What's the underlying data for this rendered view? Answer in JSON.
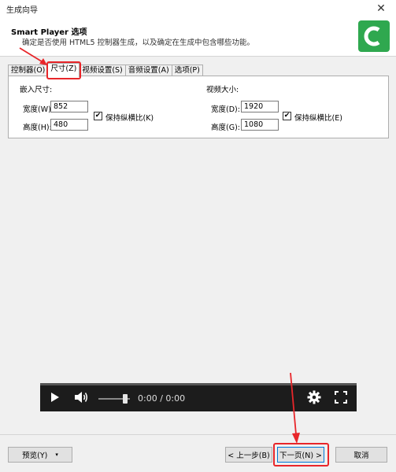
{
  "window": {
    "title": "生成向导",
    "close_glyph": "✕"
  },
  "header": {
    "title": "Smart Player 选项",
    "subtitle": "确定是否使用 HTML5 控制器生成，以及确定在生成中包含哪些功能。",
    "logo_color": "#2fa84f"
  },
  "tabs": [
    {
      "label": "控制器(O)"
    },
    {
      "label": "尺寸(Z)",
      "active": true
    },
    {
      "label": "视频设置(S)"
    },
    {
      "label": "音频设置(A)"
    },
    {
      "label": "选项(P)"
    }
  ],
  "embed": {
    "heading": "嵌入尺寸:",
    "width_label": "宽度(W):",
    "width_value": "852",
    "height_label": "高度(H):",
    "height_value": "480",
    "keep_ratio_label": "保持纵横比(K)",
    "keep_ratio_checked": true
  },
  "video": {
    "heading": "视频大小:",
    "width_label": "宽度(D):",
    "width_value": "1920",
    "height_label": "高度(G):",
    "height_value": "1080",
    "keep_ratio_label": "保持纵横比(E)",
    "keep_ratio_checked": true
  },
  "player": {
    "time": "0:00 / 0:00",
    "progress": 0,
    "volume": 0.85
  },
  "footer": {
    "preview_label": "预览(Y)",
    "prev_label": "< 上一步(B)",
    "next_label": "下一页(N) >",
    "cancel_label": "取消"
  },
  "colors": {
    "annotation_red": "#e8262a",
    "focus_blue": "#0078d7"
  }
}
